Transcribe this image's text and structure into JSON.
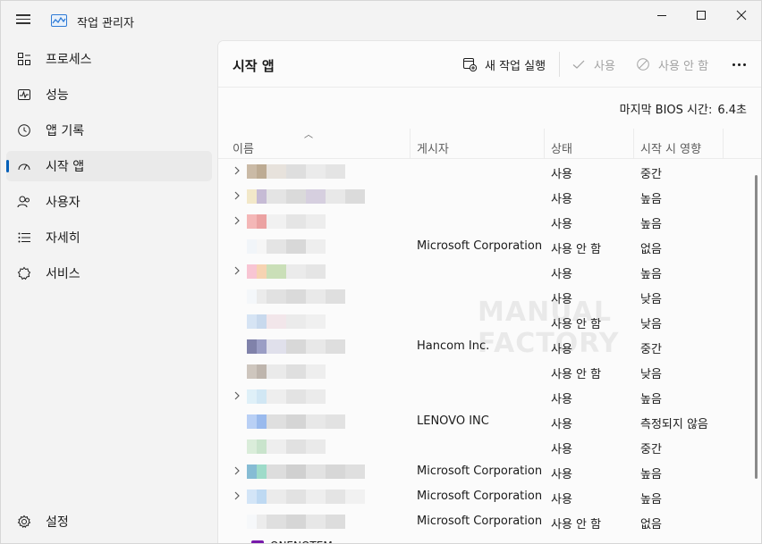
{
  "window": {
    "title": "작업 관리자"
  },
  "sidebar": {
    "items": [
      {
        "label": "프로세스",
        "icon": "processes-icon"
      },
      {
        "label": "성능",
        "icon": "performance-icon"
      },
      {
        "label": "앱 기록",
        "icon": "app-history-icon"
      },
      {
        "label": "시작 앱",
        "icon": "startup-apps-icon",
        "active": true
      },
      {
        "label": "사용자",
        "icon": "users-icon"
      },
      {
        "label": "자세히",
        "icon": "details-icon"
      },
      {
        "label": "서비스",
        "icon": "services-icon"
      }
    ],
    "settings_label": "설정"
  },
  "toolbar": {
    "page_title": "시작 앱",
    "new_task_label": "새 작업 실행",
    "enable_label": "사용",
    "disable_label": "사용 안 함"
  },
  "bios": {
    "label": "마지막 BIOS 시간:",
    "value": "6.4초"
  },
  "table": {
    "columns": {
      "name": "이름",
      "publisher": "게시자",
      "status": "상태",
      "impact": "시작 시 영향"
    },
    "rows": [
      {
        "expandable": true,
        "publisher": "",
        "status": "사용",
        "impact": "중간"
      },
      {
        "expandable": true,
        "publisher": "",
        "status": "사용",
        "impact": "높음"
      },
      {
        "expandable": true,
        "publisher": "",
        "status": "사용",
        "impact": "높음"
      },
      {
        "expandable": false,
        "publisher": "Microsoft Corporation",
        "status": "사용 안 함",
        "impact": "없음"
      },
      {
        "expandable": true,
        "publisher": "",
        "status": "사용",
        "impact": "높음"
      },
      {
        "expandable": false,
        "publisher": "",
        "status": "사용",
        "impact": "낮음"
      },
      {
        "expandable": false,
        "publisher": "",
        "status": "사용 안 함",
        "impact": "낮음"
      },
      {
        "expandable": false,
        "publisher": "Hancom Inc.",
        "status": "사용",
        "impact": "중간"
      },
      {
        "expandable": false,
        "publisher": "",
        "status": "사용 안 함",
        "impact": "낮음"
      },
      {
        "expandable": true,
        "publisher": "",
        "status": "사용",
        "impact": "높음"
      },
      {
        "expandable": false,
        "publisher": "LENOVO INC",
        "status": "사용",
        "impact": "측정되지 않음"
      },
      {
        "expandable": false,
        "publisher": "",
        "status": "사용",
        "impact": "중간"
      },
      {
        "expandable": true,
        "publisher": "Microsoft Corporation",
        "status": "사용",
        "impact": "높음"
      },
      {
        "expandable": true,
        "publisher": "Microsoft Corporation",
        "status": "사용",
        "impact": "높음"
      },
      {
        "expandable": false,
        "publisher": "Microsoft Corporation",
        "status": "사용 안 함",
        "impact": "없음"
      },
      {
        "expandable": false,
        "name": "ONENOTEM",
        "publisher": "",
        "status": "사용",
        "impact": "중간"
      }
    ]
  },
  "watermark": "MANUAL FACTORY",
  "colors": {
    "accent": "#005fb8",
    "disabled_text": "#a3a3a3",
    "onenote": "#7719aa"
  }
}
